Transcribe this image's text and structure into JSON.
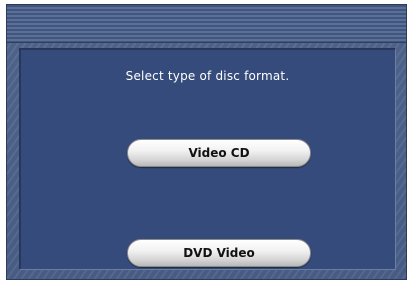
{
  "dialog": {
    "prompt": "Select type of disc format.",
    "buttons": {
      "video_cd": "Video CD",
      "dvd_video": "DVD Video"
    }
  },
  "colors": {
    "panel_background": "#354b7b",
    "frame_background": "#4f6590",
    "button_text": "#111111",
    "prompt_text": "#ffffff"
  }
}
